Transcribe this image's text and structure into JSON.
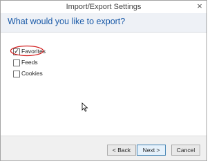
{
  "window": {
    "title": "Import/Export Settings",
    "close_symbol": "×"
  },
  "header": {
    "question": "What would you like to export?"
  },
  "options": [
    {
      "label": "Favorites",
      "checked": true,
      "annotated": true
    },
    {
      "label": "Feeds",
      "checked": false
    },
    {
      "label": "Cookies",
      "checked": false
    }
  ],
  "buttons": {
    "back": "< Back",
    "next": "Next >",
    "cancel": "Cancel"
  },
  "colors": {
    "heading": "#1a5aa8",
    "annotation": "#d11a1a"
  },
  "icons": {
    "close": "close-icon",
    "cursor": "mouse-pointer-icon",
    "check": "checkmark-icon"
  }
}
